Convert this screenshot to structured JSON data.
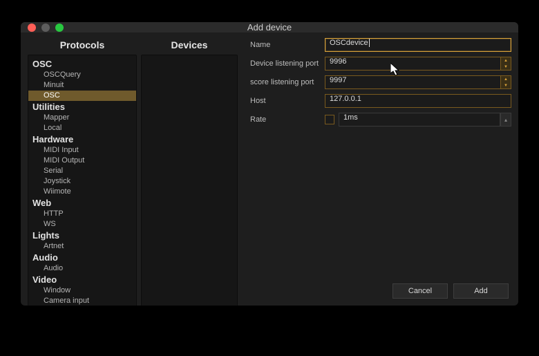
{
  "window": {
    "title": "Add device"
  },
  "columns": {
    "protocols": "Protocols",
    "devices": "Devices"
  },
  "tree": [
    {
      "cat": "OSC",
      "items": [
        "OSCQuery",
        "Minuit",
        "OSC"
      ],
      "selectedIndex": 2
    },
    {
      "cat": "Utilities",
      "items": [
        "Mapper",
        "Local"
      ]
    },
    {
      "cat": "Hardware",
      "items": [
        "MIDI Input",
        "MIDI Output",
        "Serial",
        "Joystick",
        "Wiimote"
      ]
    },
    {
      "cat": "Web",
      "items": [
        "HTTP",
        "WS"
      ]
    },
    {
      "cat": "Lights",
      "items": [
        "Artnet"
      ]
    },
    {
      "cat": "Audio",
      "items": [
        "Audio"
      ]
    },
    {
      "cat": "Video",
      "items": [
        "Window",
        "Camera input"
      ]
    }
  ],
  "form": {
    "name_label": "Name",
    "name_value": "OSCdevice",
    "device_port_label": "Device listening port",
    "device_port_value": "9996",
    "score_port_label": "score listening port",
    "score_port_value": "9997",
    "host_label": "Host",
    "host_value": "127.0.0.1",
    "rate_label": "Rate",
    "rate_value": "1ms",
    "rate_checked": false
  },
  "buttons": {
    "cancel": "Cancel",
    "add": "Add"
  },
  "colors": {
    "accent": "#d9a23a",
    "selected_bg": "#6f5a2c"
  }
}
